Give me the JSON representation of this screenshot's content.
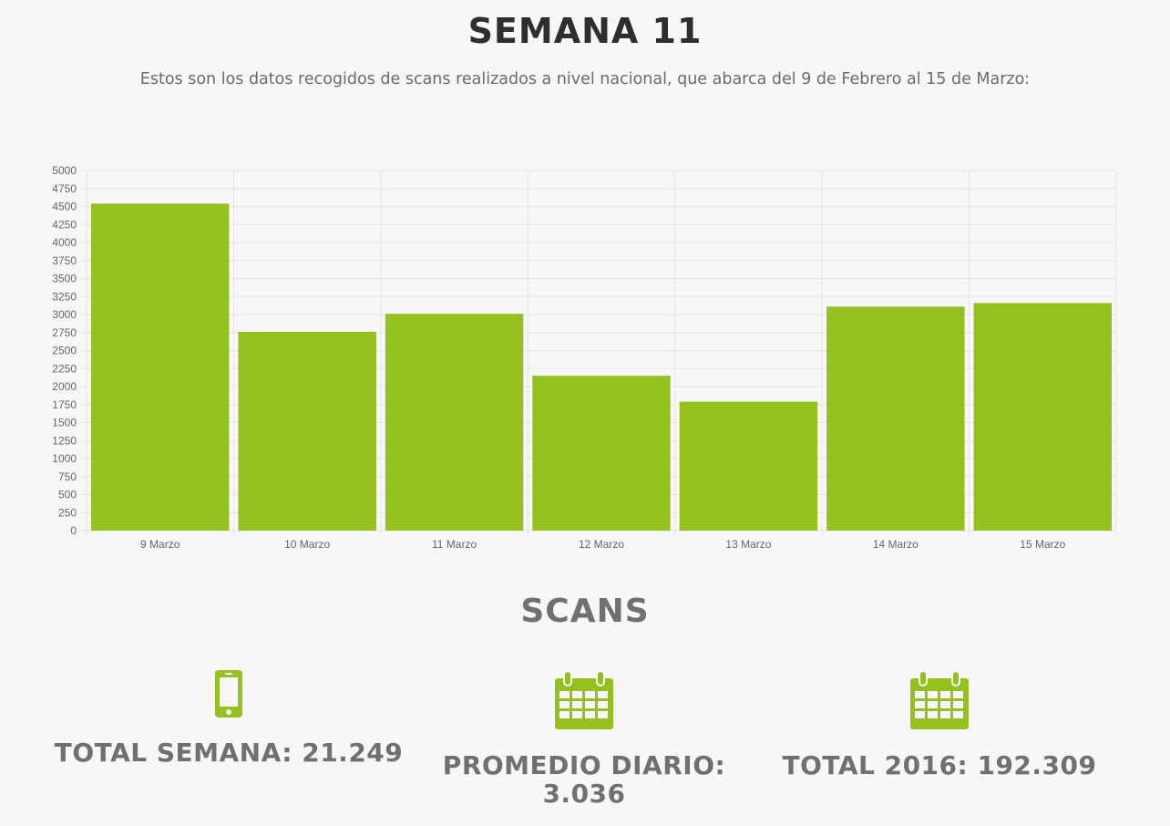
{
  "header": {
    "title": "SEMANA 11",
    "subtitle": "Estos son los datos recogidos de scans realizados a nivel nacional, que abarca del 9 de Febrero al 15 de Marzo:"
  },
  "chart_data": {
    "type": "bar",
    "categories": [
      "9 Marzo",
      "10 Marzo",
      "11 Marzo",
      "12 Marzo",
      "13 Marzo",
      "14 Marzo",
      "15 Marzo"
    ],
    "values": [
      4540,
      2760,
      3010,
      2150,
      1790,
      3110,
      3160
    ],
    "ylim": [
      0,
      5000
    ],
    "ytick_step": 250,
    "bar_color": "#95c120",
    "grid": true
  },
  "scans": {
    "title": "SCANS",
    "accent_color": "#95c120",
    "stats": [
      {
        "icon": "smartphone-icon",
        "label": "TOTAL SEMANA: 21.249"
      },
      {
        "icon": "calendar-icon",
        "label": "PROMEDIO DIARIO: 3.036"
      },
      {
        "icon": "calendar-icon",
        "label": "TOTAL 2016: 192.309"
      }
    ]
  }
}
